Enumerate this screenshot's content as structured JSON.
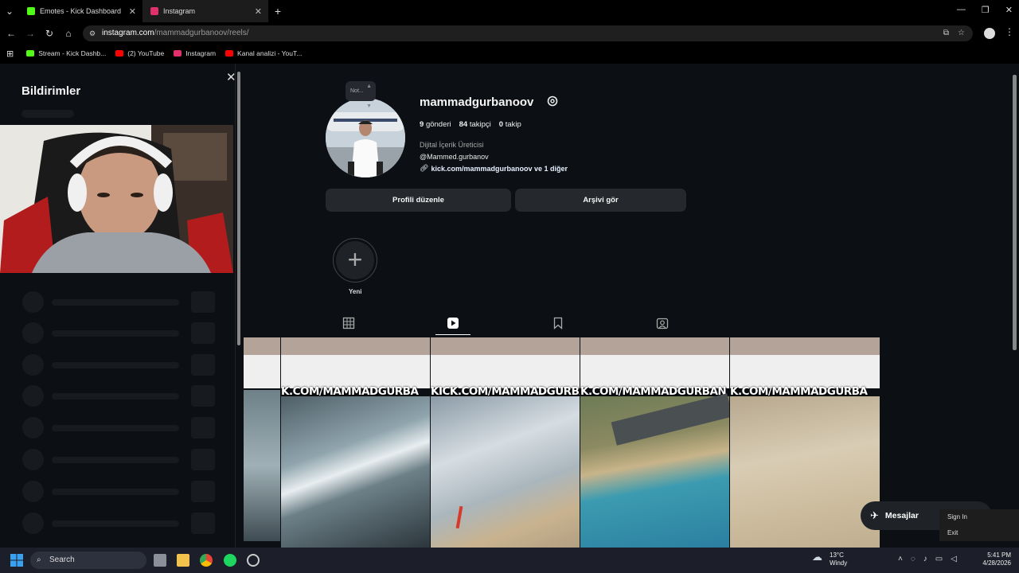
{
  "browser": {
    "tabs": [
      {
        "title": "Emotes - Kick Dashboard",
        "color": "#53fc18"
      },
      {
        "title": "Instagram",
        "color": "#e1306c"
      }
    ],
    "url_host": "instagram.com",
    "url_path": "/mammadgurbanoov/reels/",
    "bookmarks": [
      {
        "label": "Stream - Kick Dashb...",
        "color": "#53fc18"
      },
      {
        "label": "(2) YouTube",
        "color": "#ff0000"
      },
      {
        "label": "Instagram",
        "color": "#e1306c"
      },
      {
        "label": "Kanal analizi - YouT...",
        "color": "#ff0000"
      }
    ]
  },
  "notifications": {
    "title": "Bildirimler"
  },
  "profile": {
    "note": "Not...",
    "username": "mammadgurbanoov",
    "posts_count": "9",
    "posts_label": "gönderi",
    "followers_count": "84",
    "followers_label": "takipçi",
    "following_count": "0",
    "following_label": "takip",
    "category": "Dijital İçerik Üreticisi",
    "handle": "@Mammed.gurbanov",
    "link": "kick.com/mammadgurbanoov ve 1 diğer",
    "edit_button": "Profili düzenle",
    "archive_button": "Arşivi gör",
    "new_highlight": "Yeni"
  },
  "reels": [
    {
      "caption": "K.COM/MAMMADGURBA"
    },
    {
      "caption": "KICK.COM/MAMMADGURBANO"
    },
    {
      "caption": "K.COM/MAMMADGURBAN"
    },
    {
      "caption": "K.COM/MAMMADGURBA"
    }
  ],
  "messages_button": "Mesajlar",
  "context_menu": [
    "Sign In",
    "Exit"
  ],
  "taskbar": {
    "search_placeholder": "Search",
    "weather_temp": "13°C",
    "weather_desc": "Windy",
    "time": "5:41 PM",
    "date": "4/28/2026"
  }
}
